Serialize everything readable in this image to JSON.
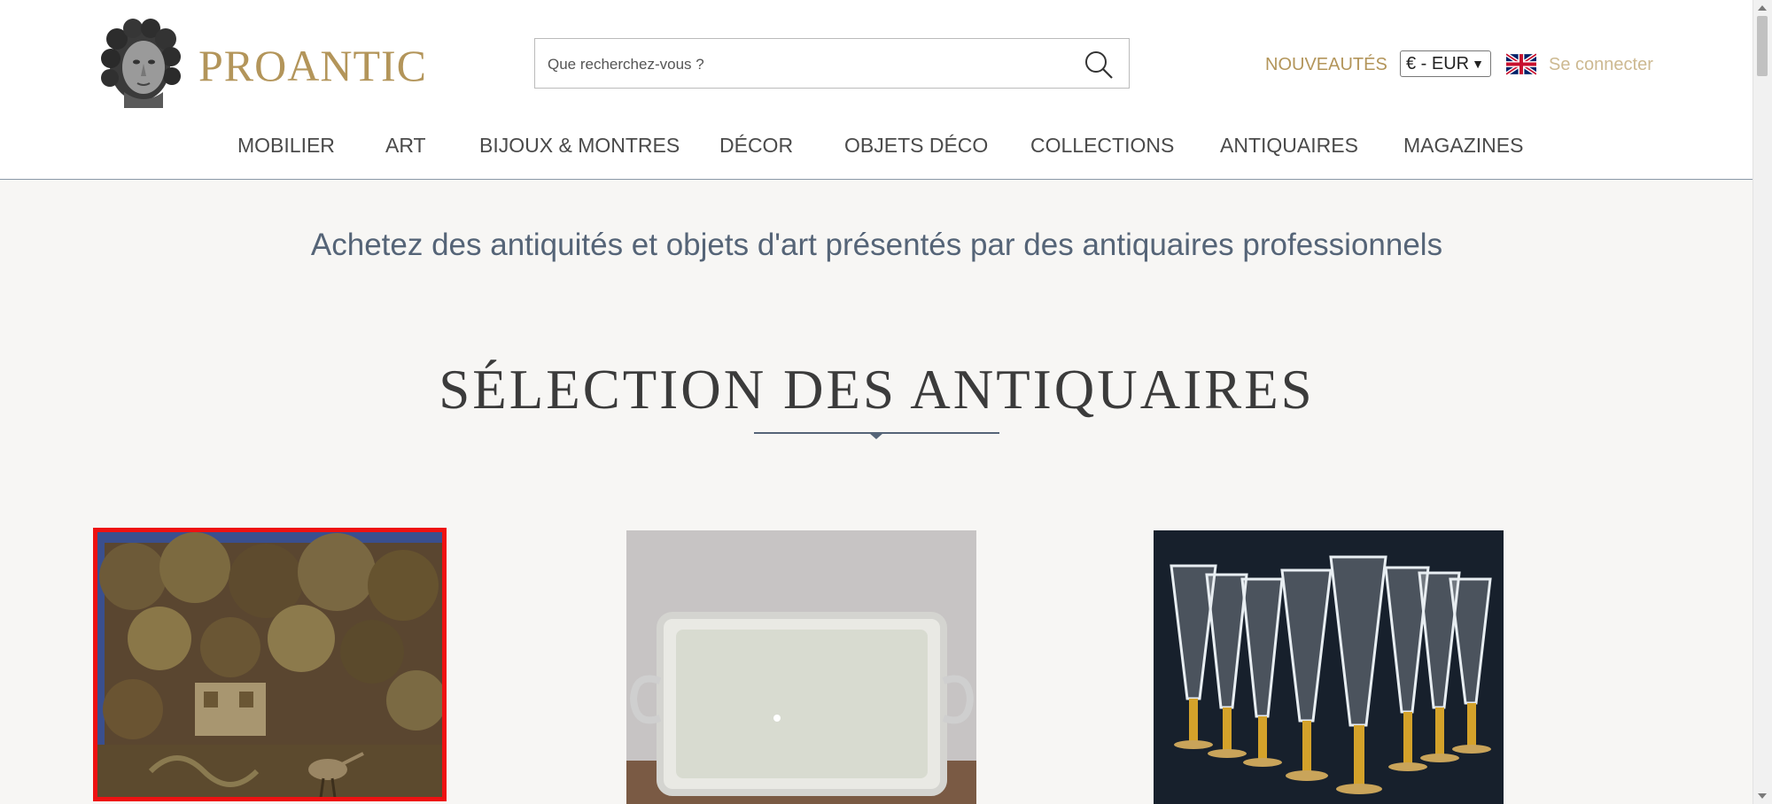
{
  "header": {
    "logo_text": "PROANTIC",
    "logo_icon": "classical-bust-logo",
    "search": {
      "placeholder": "Que recherchez-vous ?",
      "icon": "search-icon"
    },
    "nouveautes": "NOUVEAUTÉS",
    "currency": "€ - EUR",
    "language_flag": "uk-flag-icon",
    "login": "Se connecter"
  },
  "nav": {
    "items": [
      "MOBILIER",
      "ART",
      "BIJOUX & MONTRES",
      "DÉCOR",
      "OBJETS DÉCO",
      "COLLECTIONS",
      "ANTIQUAIRES",
      "MAGAZINES"
    ]
  },
  "main": {
    "tagline": "Achetez des antiquités et objets d'art présentés par des antiquaires professionnels",
    "section_title": "SÉLECTION DES ANTIQUAIRES",
    "products": [
      {
        "image": "tapestry-verdure-bird"
      },
      {
        "image": "silver-serving-tray"
      },
      {
        "image": "crystal-gilded-glasses"
      }
    ]
  },
  "colors": {
    "brand_gold": "#b3955a",
    "tagline_blue": "#556477",
    "highlight_red": "#ee1111"
  }
}
